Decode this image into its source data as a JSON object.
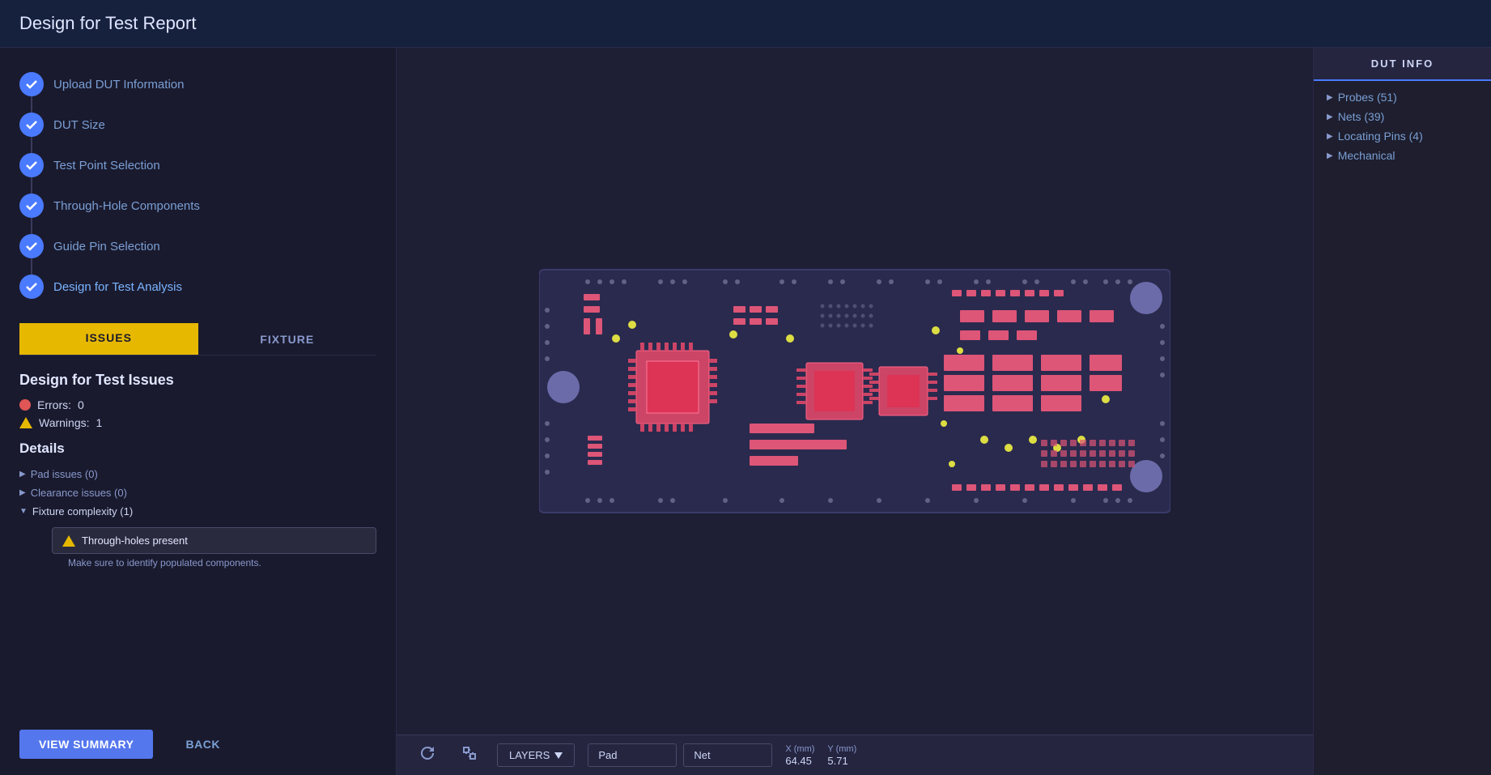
{
  "header": {
    "title": "Design for Test Report"
  },
  "sidebar": {
    "steps": [
      {
        "id": "upload-dut",
        "label": "Upload DUT Information",
        "status": "completed"
      },
      {
        "id": "dut-size",
        "label": "DUT Size",
        "status": "completed"
      },
      {
        "id": "test-point",
        "label": "Test Point Selection",
        "status": "completed"
      },
      {
        "id": "through-hole",
        "label": "Through-Hole Components",
        "status": "completed"
      },
      {
        "id": "guide-pin",
        "label": "Guide Pin Selection",
        "status": "completed"
      },
      {
        "id": "dft-analysis",
        "label": "Design for Test Analysis",
        "status": "active"
      }
    ],
    "tabs": [
      {
        "id": "issues",
        "label": "ISSUES",
        "active": true
      },
      {
        "id": "fixture",
        "label": "FIXTURE",
        "active": false
      }
    ],
    "issues": {
      "title": "Design for Test Issues",
      "errors_label": "Errors:",
      "errors_count": "0",
      "warnings_label": "Warnings:",
      "warnings_count": "1",
      "details_title": "Details",
      "tree_items": [
        {
          "label": "Pad issues (0)",
          "expanded": false,
          "arrow": "▶"
        },
        {
          "label": "Clearance issues (0)",
          "expanded": false,
          "arrow": "▶"
        },
        {
          "label": "Fixture complexity (1)",
          "expanded": true,
          "arrow": "▼"
        }
      ],
      "warning_item": {
        "text": "Through-holes present",
        "hint": "Make sure to identify populated components."
      }
    },
    "buttons": {
      "view_summary": "VIEW SUMMARY",
      "back": "BACK"
    }
  },
  "dut_info": {
    "header": "DUT INFO",
    "tree_items": [
      {
        "label": "Probes (51)",
        "arrow": "▶"
      },
      {
        "label": "Nets (39)",
        "arrow": "▶"
      },
      {
        "label": "Locating Pins (4)",
        "arrow": "▶"
      },
      {
        "label": "Mechanical",
        "arrow": "▶"
      }
    ]
  },
  "toolbar": {
    "layers_label": "LAYERS",
    "pad_label": "Pad",
    "net_label": "Net",
    "x_label": "X (mm)",
    "x_value": "64.45",
    "y_label": "Y (mm)",
    "y_value": "5.71"
  }
}
